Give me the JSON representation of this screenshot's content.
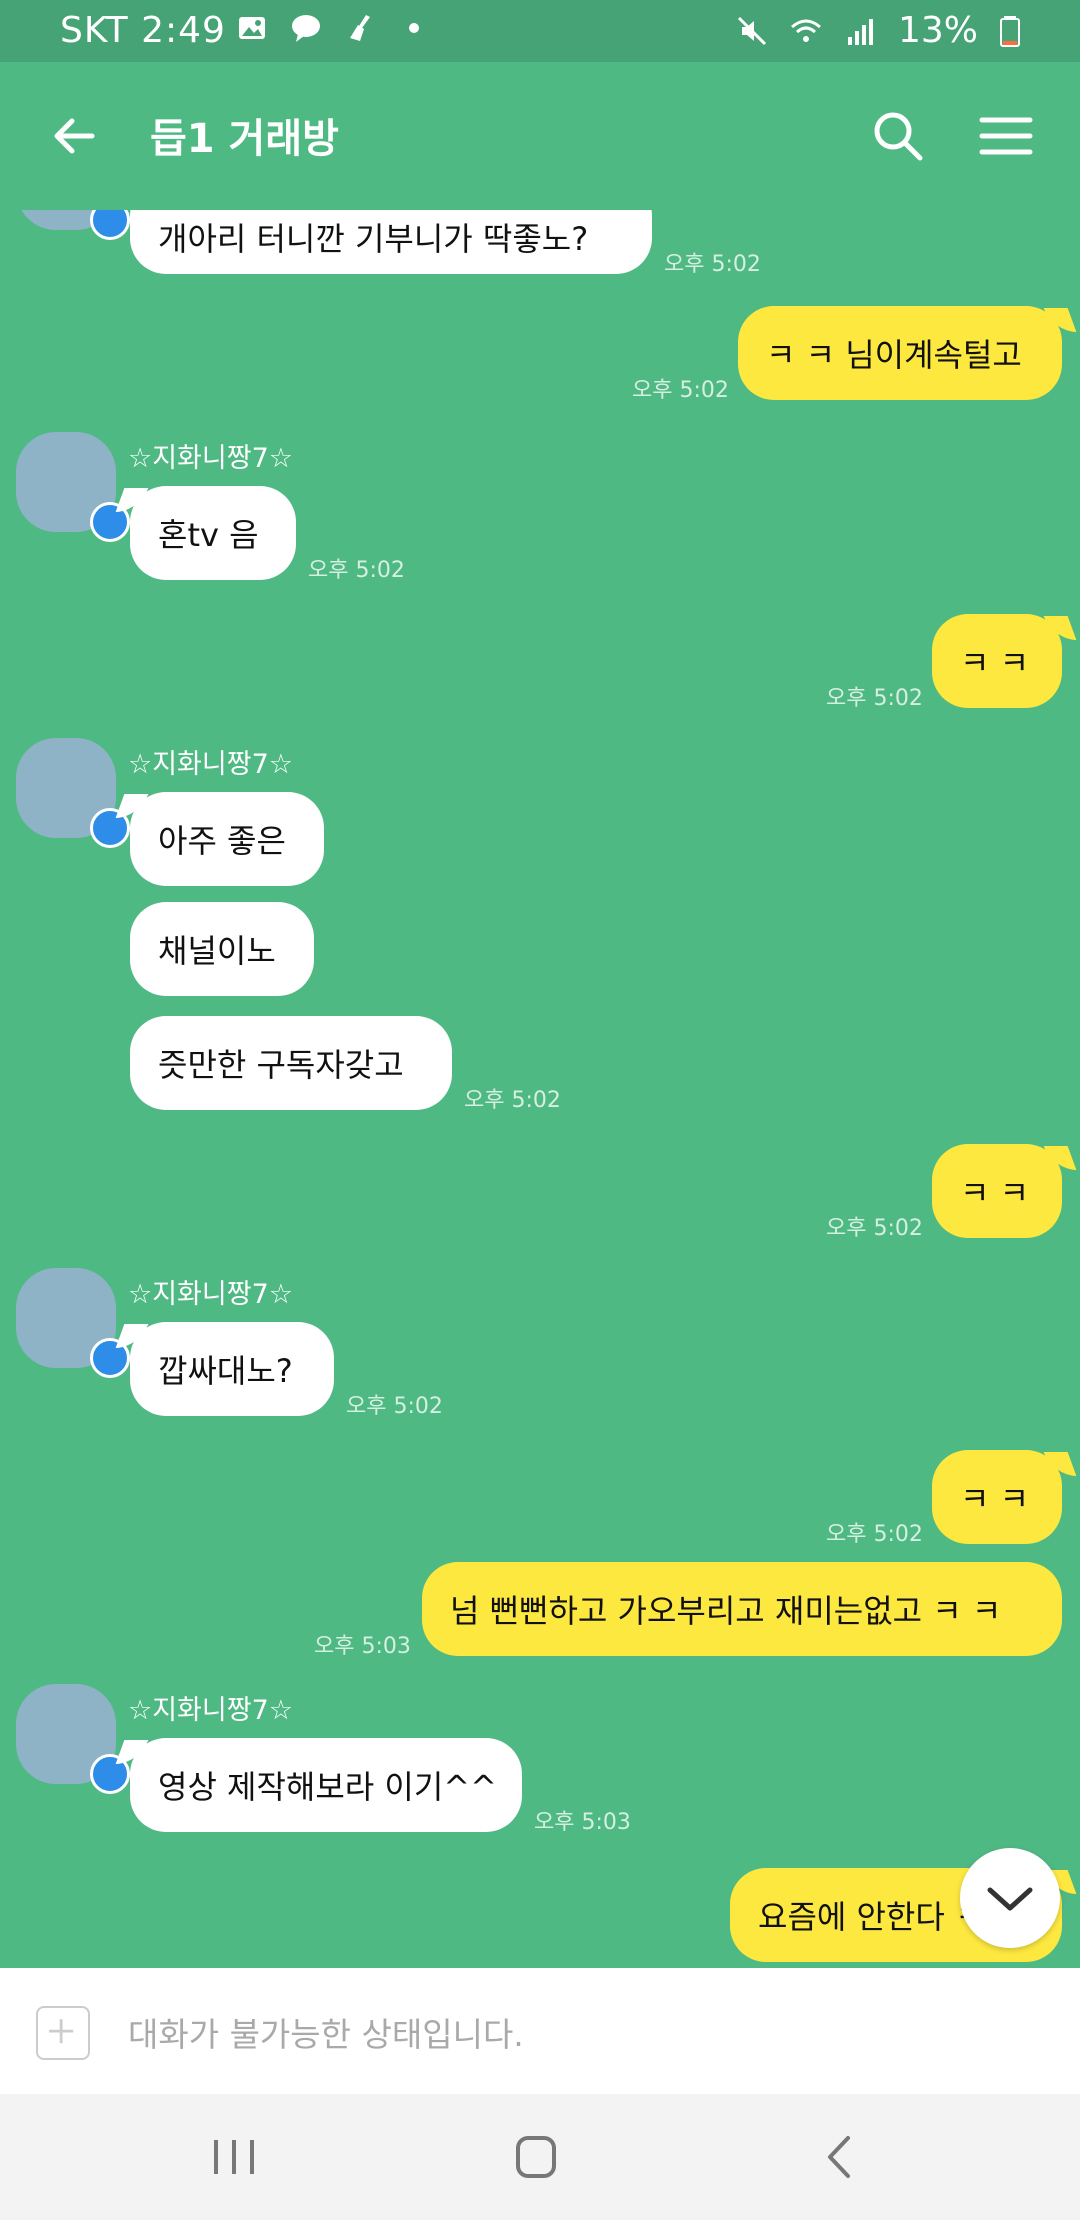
{
  "status_bar": {
    "carrier": "SKT",
    "time": "2:49",
    "battery": "13%",
    "icons": [
      "image-icon",
      "talk-icon",
      "broom-icon",
      "dot-icon",
      "mute-icon",
      "wifi-icon",
      "signal-icon",
      "battery-icon"
    ]
  },
  "header": {
    "title": "듭1 거래방",
    "icons": [
      "back-arrow-icon",
      "search-icon",
      "hamburger-menu-icon"
    ]
  },
  "messages": [
    {
      "from": "other",
      "text": "개아리 터니깐 기부니가 딱좋노?",
      "time": "오후 5:02"
    },
    {
      "from": "me",
      "text": "ㅋ ㅋ 님이계속털고",
      "time": "오후 5:02"
    },
    {
      "from": "other",
      "sender": "☆지화니짱7☆",
      "text": "혼tv 음",
      "time": "오후 5:02"
    },
    {
      "from": "me",
      "text": "ㅋ ㅋ",
      "time": "오후 5:02"
    },
    {
      "from": "other",
      "sender": "☆지화니짱7☆",
      "text": "아주 좋은"
    },
    {
      "from": "other",
      "text": "채널이노"
    },
    {
      "from": "other",
      "text": "즛만한 구독자갖고",
      "time": "오후 5:02"
    },
    {
      "from": "me",
      "text": "ㅋ ㅋ",
      "time": "오후 5:02"
    },
    {
      "from": "other",
      "sender": "☆지화니짱7☆",
      "text": "깝싸대노?",
      "time": "오후 5:02"
    },
    {
      "from": "me",
      "text": "ㅋ ㅋ",
      "time": "오후 5:02"
    },
    {
      "from": "me",
      "text": "넘 뻔뻔하고 가오부리고 재미는없고 ㅋ ㅋ",
      "time": "오후 5:03"
    },
    {
      "from": "other",
      "sender": "☆지화니짱7☆",
      "text": "영상 제작해보라 이기^^",
      "time": "오후 5:03"
    },
    {
      "from": "me",
      "text": "요즘에 안한다 ㅋ ㅋ"
    }
  ],
  "input": {
    "placeholder": "대화가 불가능한 상태입니다."
  },
  "colors": {
    "chat_background": "#4fb984",
    "status_bar": "#45a375",
    "my_bubble": "#fde840",
    "their_bubble": "#ffffff",
    "crown_badge": "#2d8de8"
  }
}
